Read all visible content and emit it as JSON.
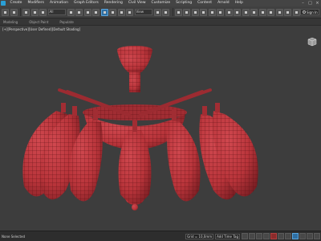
{
  "menu": {
    "items": [
      "Create",
      "Modifiers",
      "Animation",
      "Graph Editors",
      "Rendering",
      "Civil View",
      "Customize",
      "Scripting",
      "Content",
      "Arnold",
      "Help"
    ]
  },
  "toolbar": {
    "selection_filter": "All",
    "ref_coord": "View",
    "search_placeholder": "Sign In"
  },
  "ribbon": {
    "tabs": [
      "Modeling",
      "Object Paint",
      "Populate"
    ]
  },
  "viewport": {
    "label": "[+][Perspective][User Defined][Default Shading]"
  },
  "status": {
    "message": "None Selected",
    "x_value": "",
    "y_value": "",
    "grid": "Grid = 10,0mm",
    "time_tag": "Add Time Tag"
  },
  "colors": {
    "mesh": "#b8343a",
    "wire": "#5a0f14",
    "background": "#3d3d3d"
  }
}
